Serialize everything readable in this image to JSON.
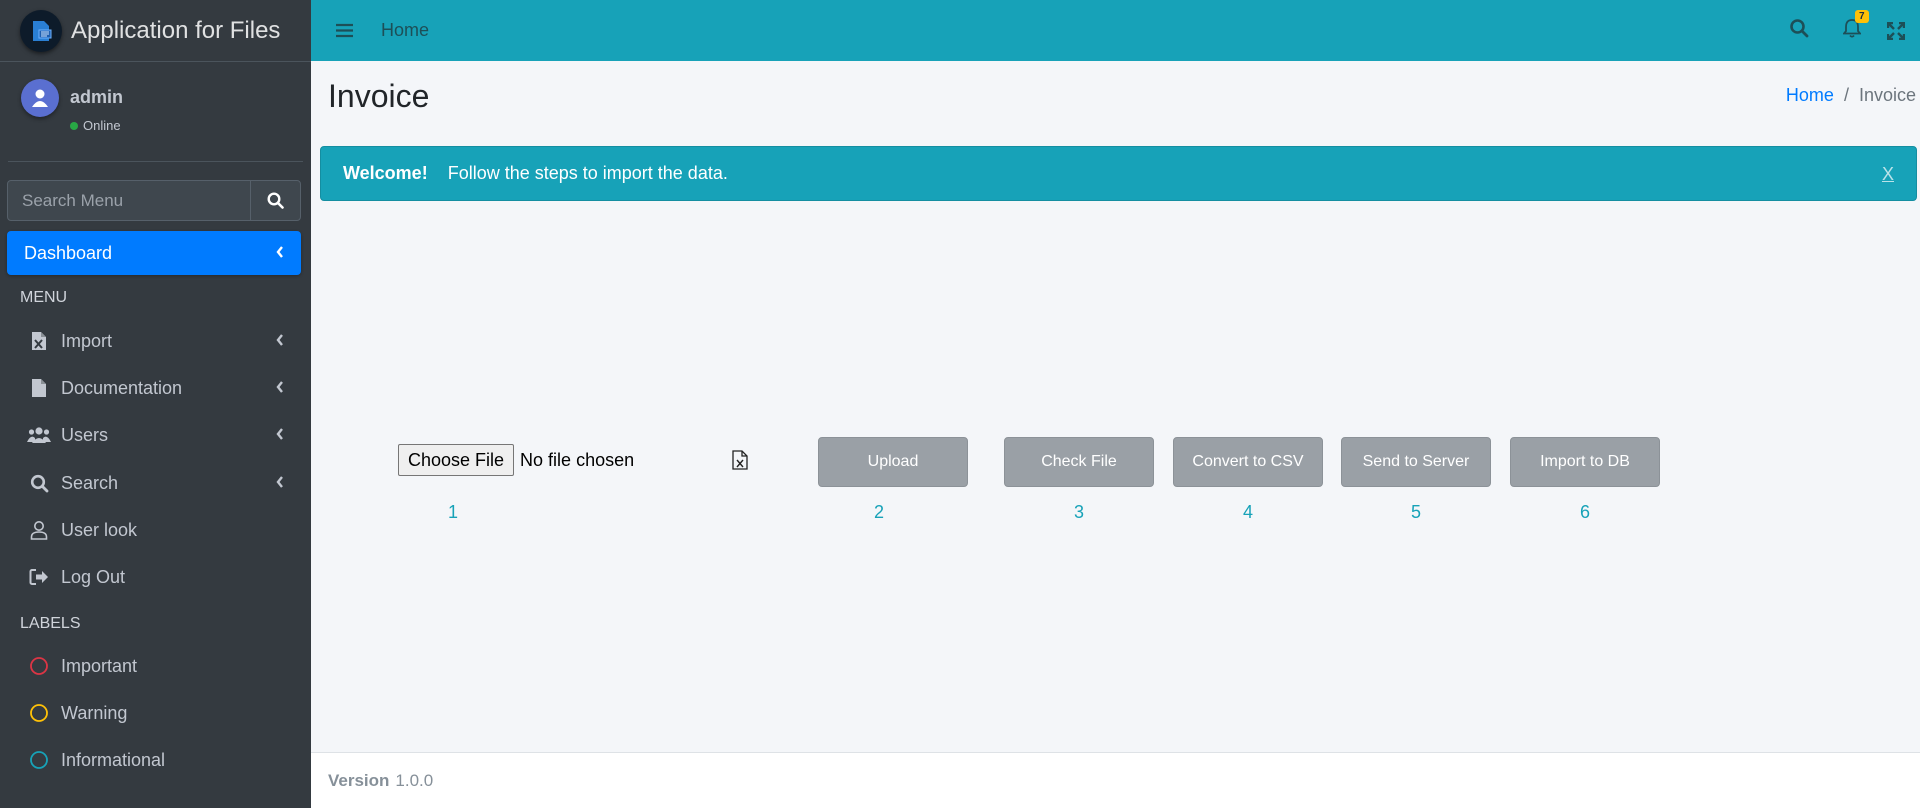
{
  "app": {
    "title": "Application for Files"
  },
  "user": {
    "name": "admin",
    "status": "Online"
  },
  "sidebar": {
    "search_placeholder": "Search Menu",
    "active_item": "Dashboard",
    "menu_header": "MENU",
    "items": [
      {
        "label": "Import",
        "icon": "file-excel-icon",
        "has_chevron": true
      },
      {
        "label": "Documentation",
        "icon": "file-icon",
        "has_chevron": true
      },
      {
        "label": "Users",
        "icon": "users-icon",
        "has_chevron": true
      },
      {
        "label": "Search",
        "icon": "search-icon",
        "has_chevron": true
      },
      {
        "label": "User look",
        "icon": "user-icon",
        "has_chevron": false
      },
      {
        "label": "Log Out",
        "icon": "sign-out-icon",
        "has_chevron": false
      }
    ],
    "labels_header": "LABELS",
    "labels": [
      {
        "label": "Important",
        "color": "#dc3545"
      },
      {
        "label": "Warning",
        "color": "#ffc107"
      },
      {
        "label": "Informational",
        "color": "#17a2b8"
      }
    ]
  },
  "topbar": {
    "home": "Home",
    "notification_count": "7"
  },
  "page": {
    "title": "Invoice"
  },
  "breadcrumb": {
    "home": "Home",
    "separator": "/",
    "current": "Invoice"
  },
  "alert": {
    "strong": "Welcome!",
    "text": "Follow the steps to import the data.",
    "close": "X"
  },
  "file_input": {
    "button": "Choose File",
    "status": "No file chosen"
  },
  "steps": [
    {
      "num": "1"
    },
    {
      "label": "Upload",
      "num": "2"
    },
    {
      "label": "Check File",
      "num": "3"
    },
    {
      "label": "Convert to CSV",
      "num": "4"
    },
    {
      "label": "Send to Server",
      "num": "5"
    },
    {
      "label": "Import to DB",
      "num": "6"
    }
  ],
  "footer": {
    "label": "Version",
    "version": "1.0.0"
  },
  "colors": {
    "accent": "#17a2b8",
    "primary": "#007bff",
    "sidebar_bg": "#343a40",
    "button_disabled": "#9aa0a6"
  }
}
